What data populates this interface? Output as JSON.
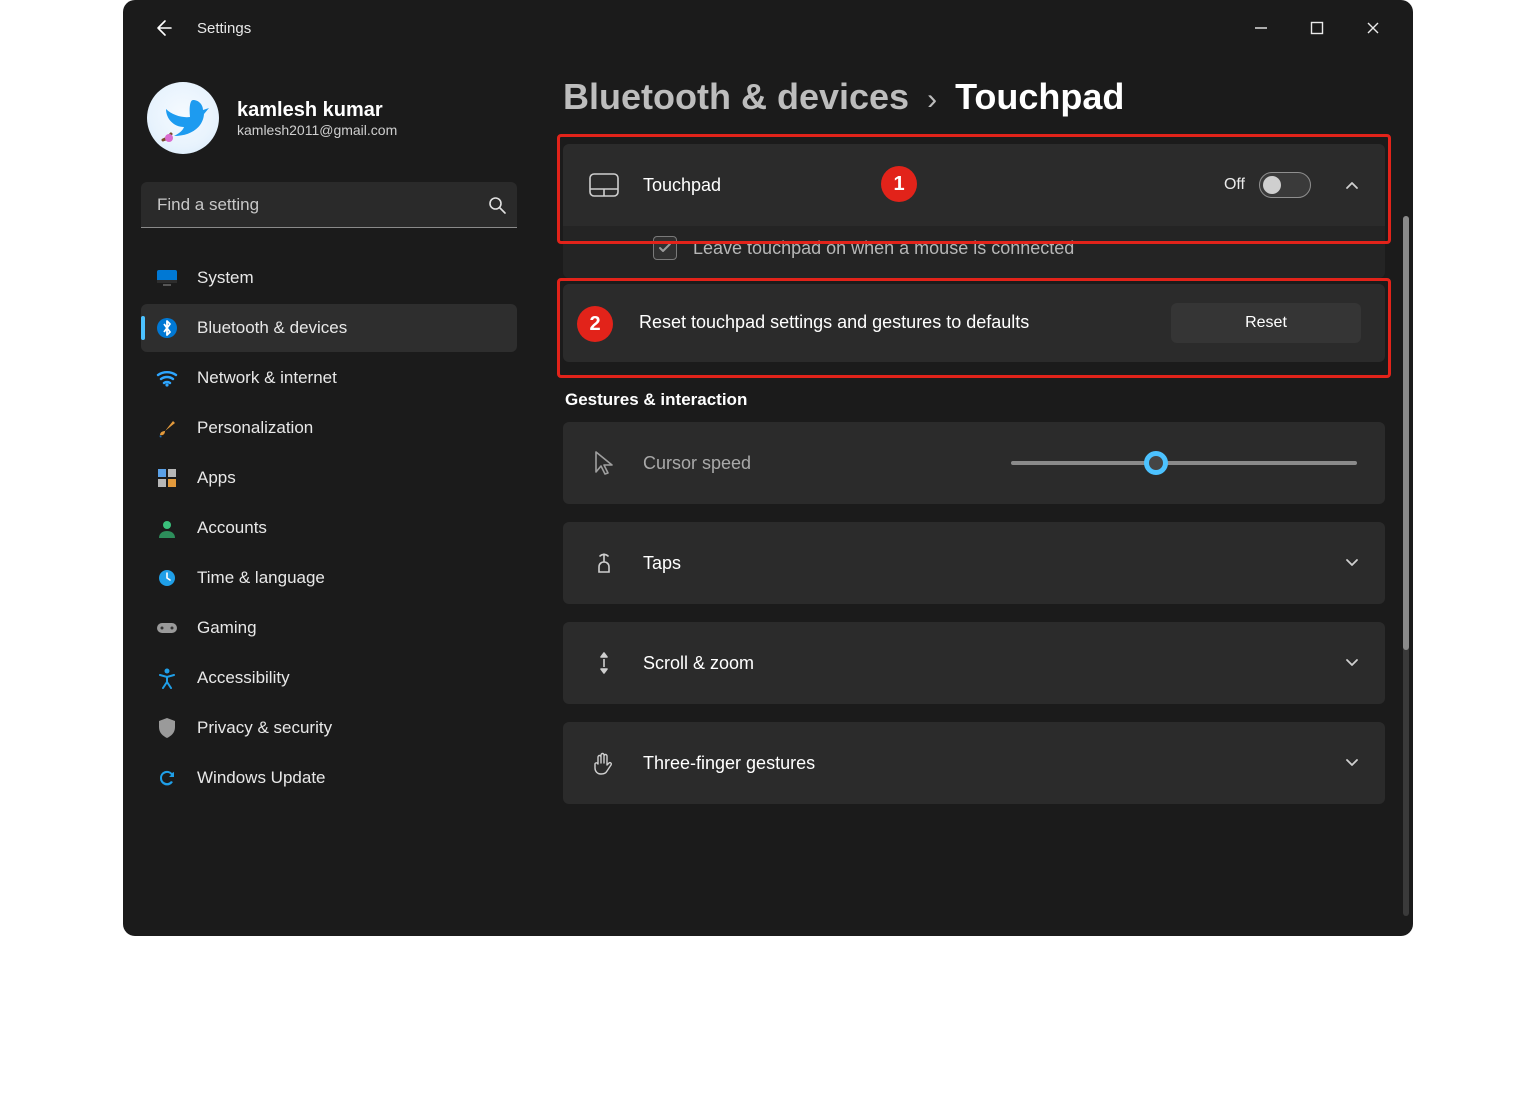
{
  "app": {
    "title": "Settings"
  },
  "profile": {
    "name": "kamlesh kumar",
    "email": "kamlesh2011@gmail.com"
  },
  "search": {
    "placeholder": "Find a setting"
  },
  "sidebar": {
    "items": [
      {
        "label": "System"
      },
      {
        "label": "Bluetooth & devices"
      },
      {
        "label": "Network & internet"
      },
      {
        "label": "Personalization"
      },
      {
        "label": "Apps"
      },
      {
        "label": "Accounts"
      },
      {
        "label": "Time & language"
      },
      {
        "label": "Gaming"
      },
      {
        "label": "Accessibility"
      },
      {
        "label": "Privacy & security"
      },
      {
        "label": "Windows Update"
      }
    ],
    "active_index": 1
  },
  "breadcrumb": {
    "parent": "Bluetooth & devices",
    "separator": "›",
    "leaf": "Touchpad"
  },
  "touchpad": {
    "title": "Touchpad",
    "state_label": "Off",
    "state_on": false,
    "leave_on_label": "Leave touchpad on when a mouse is connected",
    "leave_on_checked": true,
    "reset_text": "Reset touchpad settings and gestures to defaults",
    "reset_button": "Reset"
  },
  "gestures_section": {
    "heading": "Gestures & interaction"
  },
  "cursor_speed": {
    "title": "Cursor speed",
    "value_pct": 42
  },
  "rows": [
    {
      "title": "Taps"
    },
    {
      "title": "Scroll & zoom"
    },
    {
      "title": "Three-finger gestures"
    }
  ],
  "annotations": {
    "one": "1",
    "two": "2"
  }
}
